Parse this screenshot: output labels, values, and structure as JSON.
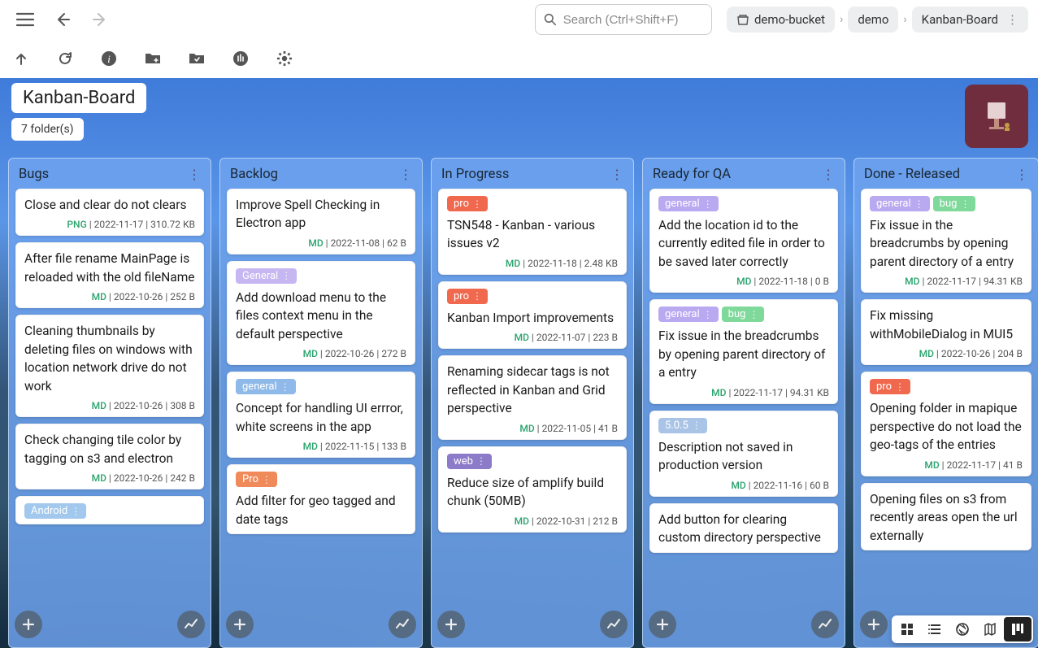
{
  "search": {
    "placeholder": "Search (Ctrl+Shift+F)"
  },
  "breadcrumbs": [
    {
      "label": "demo-bucket",
      "has_icon": true
    },
    {
      "label": "demo",
      "has_icon": false
    },
    {
      "label": "Kanban-Board",
      "has_icon": false,
      "has_more": true
    }
  ],
  "board": {
    "title": "Kanban-Board",
    "subtitle": "7 folder(s)"
  },
  "tag_colors": {
    "pro_red": "#f0694e",
    "pro_orange": "#f08a5a",
    "general_purple": "#b8a9f0",
    "general_blue": "#8fb9e8",
    "bug_green": "#7fd99b",
    "web_purple": "#8b7bc9",
    "android_blue": "#a2c9ed",
    "version_blue": "#a9c4e6",
    "General_cap": "#c6b6f2"
  },
  "columns": [
    {
      "title": "Bugs",
      "cards": [
        {
          "tags": [],
          "title": "Close and clear do not clears",
          "ext": "PNG",
          "date": "2022-11-17",
          "size": "310.72 KB"
        },
        {
          "tags": [],
          "title": "After file rename MainPage is reloaded with the old fileName",
          "ext": "MD",
          "date": "2022-10-26",
          "size": "252 B"
        },
        {
          "tags": [],
          "title": "Cleaning thumbnails by deleting files on windows with location network drive do not work",
          "ext": "MD",
          "date": "2022-10-26",
          "size": "308 B"
        },
        {
          "tags": [],
          "title": "Check changing tile color by tagging on s3 and electron",
          "ext": "MD",
          "date": "2022-10-26",
          "size": "242 B"
        },
        {
          "tags": [
            {
              "label": "Android",
              "color": "android_blue"
            }
          ],
          "title": "",
          "partial": true
        }
      ]
    },
    {
      "title": "Backlog",
      "cards": [
        {
          "tags": [],
          "title": "Improve Spell Checking in Electron app",
          "ext": "MD",
          "date": "2022-11-08",
          "size": "62 B"
        },
        {
          "tags": [
            {
              "label": "General",
              "color": "General_cap"
            }
          ],
          "title": "Add download menu to the files context menu in the default perspective",
          "ext": "MD",
          "date": "2022-10-26",
          "size": "272 B"
        },
        {
          "tags": [
            {
              "label": "general",
              "color": "general_blue"
            }
          ],
          "title": "Concept for handling UI errror, white screens in the app",
          "ext": "MD",
          "date": "2022-11-15",
          "size": "133 B"
        },
        {
          "tags": [
            {
              "label": "Pro",
              "color": "pro_orange"
            }
          ],
          "title": "Add filter for geo tagged and date tags",
          "partial": true
        }
      ]
    },
    {
      "title": "In Progress",
      "cards": [
        {
          "tags": [
            {
              "label": "pro",
              "color": "pro_red"
            }
          ],
          "title": "TSN548 - Kanban - various issues v2",
          "ext": "MD",
          "date": "2022-11-18",
          "size": "2.48 KB"
        },
        {
          "tags": [
            {
              "label": "pro",
              "color": "pro_red"
            }
          ],
          "title": "Kanban Import improvements",
          "ext": "MD",
          "date": "2022-11-07",
          "size": "223 B"
        },
        {
          "tags": [],
          "title": "Renaming sidecar tags is not reflected in Kanban and Grid perspective",
          "ext": "MD",
          "date": "2022-11-05",
          "size": "41 B"
        },
        {
          "tags": [
            {
              "label": "web",
              "color": "web_purple"
            }
          ],
          "title": "Reduce size of amplify build chunk (50MB)",
          "ext": "MD",
          "date": "2022-10-31",
          "size": "212 B"
        }
      ]
    },
    {
      "title": "Ready for QA",
      "cards": [
        {
          "tags": [
            {
              "label": "general",
              "color": "general_purple"
            }
          ],
          "title": "Add the location id to the currently edited file in order to be saved later correctly",
          "ext": "MD",
          "date": "2022-11-18",
          "size": "0 B"
        },
        {
          "tags": [
            {
              "label": "general",
              "color": "general_purple"
            },
            {
              "label": "bug",
              "color": "bug_green"
            }
          ],
          "title": "Fix issue in the breadcrumbs by opening parent directory of a entry",
          "ext": "MD",
          "date": "2022-11-17",
          "size": "94.31 KB"
        },
        {
          "tags": [
            {
              "label": "5.0.5",
              "color": "version_blue"
            }
          ],
          "title": "Description not saved in production version",
          "ext": "MD",
          "date": "2022-11-16",
          "size": "60 B"
        },
        {
          "tags": [],
          "title": "Add button for clearing custom directory perspective",
          "partial": true
        }
      ]
    },
    {
      "title": "Done - Released",
      "cards": [
        {
          "tags": [
            {
              "label": "general",
              "color": "general_purple"
            },
            {
              "label": "bug",
              "color": "bug_green"
            }
          ],
          "title": "Fix issue in the breadcrumbs by opening parent directory of a entry",
          "ext": "MD",
          "date": "2022-11-17",
          "size": "94.31 KB"
        },
        {
          "tags": [],
          "title": "Fix missing withMobileDialog in MUI5",
          "ext": "MD",
          "date": "2022-10-26",
          "size": "204 B"
        },
        {
          "tags": [
            {
              "label": "pro",
              "color": "pro_red"
            }
          ],
          "title": "Opening folder in mapique perspective do not load the geo-tags of the entries",
          "ext": "MD",
          "date": "2022-11-17",
          "size": "41 B"
        },
        {
          "tags": [],
          "title": "Opening files on s3 from recently areas open the url externally",
          "partial": true
        }
      ]
    }
  ],
  "view_switcher": [
    "grid",
    "list",
    "aperture",
    "map",
    "kanban"
  ],
  "active_view": 4
}
